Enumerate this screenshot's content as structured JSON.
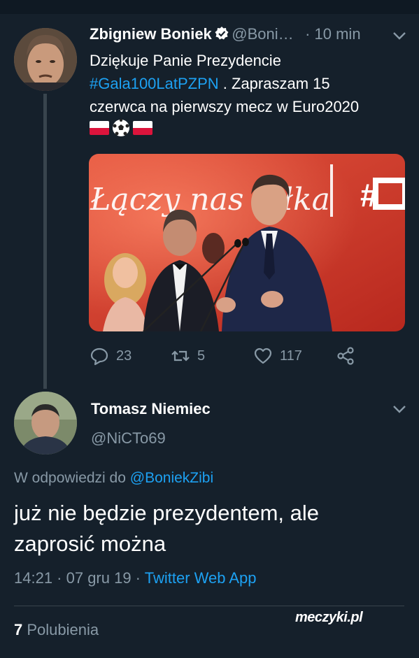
{
  "tweet": {
    "author_name": "Zbigniew Boniek",
    "author_handle": "@Boni…",
    "time": "· 10 min",
    "text_line1": "Dziękuje Panie Prezydencie",
    "hashtag": "#Gala100LatPZPN",
    "text_after_hashtag": " . Zapraszam 15",
    "text_line3": "czerwca na pierwszy mecz w Euro2020",
    "media_sign_text": "Łączy nas piłka",
    "media_hashtag": "#",
    "reply_count": "23",
    "retweet_count": "5",
    "like_count": "117"
  },
  "reply": {
    "author_name": "Tomasz Niemiec",
    "author_handle": "@NiCTo69",
    "reply_to_prefix": "W odpowiedzi do",
    "reply_to_handle": "@BoniekZibi",
    "text": "już nie będzie prezydentem, ale zaprosić można",
    "time_date": "14:21 · 07 gru 19 ·",
    "source": "Twitter Web App",
    "likes_count": "7",
    "likes_label": "Polubienia"
  },
  "watermark": "meczyki.pl",
  "colors": {
    "background": "#15202b",
    "link": "#1da1f2",
    "secondary_text": "#8899a6",
    "divider": "#38444d"
  }
}
